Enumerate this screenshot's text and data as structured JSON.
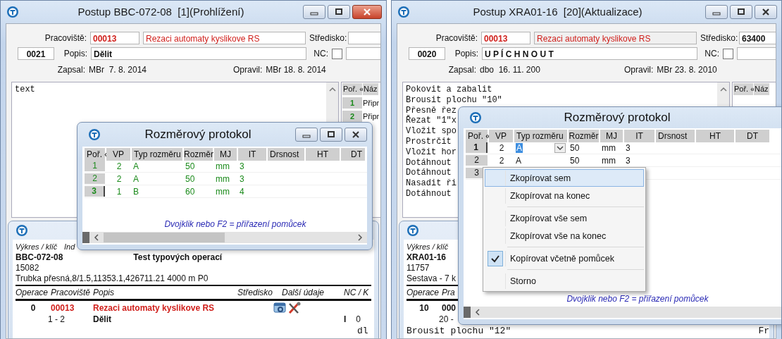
{
  "windows": [
    {
      "title": "Postup BBC-072-08  [1](Prohlížení)",
      "active": true,
      "form": {
        "workplace_label": "Pracoviště:",
        "workplace_code": "00013",
        "workplace_name": "Rezaci automaty kyslikove RS",
        "center_label": "Středisko:",
        "op_number": "0021",
        "desc_label": "Popis:",
        "desc": "Dělit",
        "nc_label": "NC:",
        "nc_checked": false,
        "created_label": "Zapsal:",
        "created": "MBr  7. 8. 2014",
        "modified_label": "Opravil:",
        "modified": "MBr 18. 8. 2014"
      },
      "notes": [
        "text"
      ],
      "side_table": {
        "columns": [
          "Poř. «",
          "Náz"
        ],
        "rows": [
          {
            "order": "1",
            "name": "Připr"
          },
          {
            "order": "2",
            "name": "Připr"
          }
        ]
      },
      "report": {
        "labels": [
          "Výkres / klíč",
          "Ind"
        ],
        "drawing": "BBC-072-08",
        "name": "Test typových operací",
        "number": "15082",
        "material": "Trubka přesná,8/1.5,11353.1,426711.21 4000 m P0",
        "columns": [
          "Operace",
          "Pracoviště",
          "Popis",
          "Středisko",
          "Další údaje",
          "NC / K"
        ],
        "rows": [
          {
            "kind": "operation",
            "number": "0",
            "workplace": "00013",
            "desc": "Rezaci automaty kyslikove RS",
            "emphasized": true,
            "tools": true
          },
          {
            "kind": "step",
            "range": "1 - 2",
            "desc": "Dělit",
            "nc": "I",
            "k": "0"
          },
          {
            "kind": "nc_note",
            "text": "dl"
          }
        ]
      },
      "dialog": {
        "title": "Rozměrový protokol",
        "controls": true,
        "readonly": true,
        "columns": [
          "Poř. «",
          "VP",
          "Typ rozměru",
          "Rozměr",
          "MJ",
          "IT",
          "Drsnost",
          "HT",
          "DT"
        ],
        "rows": [
          {
            "selected": false,
            "editing": false,
            "cells": [
              "1",
              "2",
              "A",
              "50",
              "mm",
              "3"
            ]
          },
          {
            "selected": false,
            "editing": false,
            "cells": [
              "2",
              "2",
              "A",
              "50",
              "mm",
              "3"
            ]
          },
          {
            "selected": true,
            "editing": false,
            "cells": [
              "3",
              "1",
              "B",
              "60",
              "mm",
              "4"
            ]
          }
        ],
        "hint": "Dvojklik nebo F2 = přiřazení pomůcek"
      }
    },
    {
      "title": "Postup XRA01-16  [20](Aktualizace)",
      "active": false,
      "form": {
        "workplace_label": "Pracoviště:",
        "workplace_code": "00013",
        "workplace_name": "Rezaci automaty kyslikove RS",
        "center_label": "Středisko:",
        "center_value": "63400",
        "op_number": "0020",
        "desc_label": "Popis:",
        "desc": "U P Í C H N O U T",
        "nc_label": "NC:",
        "nc_checked": false,
        "created_label": "Zapsal:",
        "created": "dbo  16. 11. 200",
        "modified_label": "Opravil:",
        "modified": "MBr 23. 8. 2010"
      },
      "notes": [
        "Pokovit a zabalit",
        "Brousit plochu \"10\"",
        "Přesně řez",
        "Řezat \"1\"x",
        "Vložit spo",
        "Prostrčit",
        "Vložit hor",
        "Dotáhnout",
        "Dotáhnout",
        "Nasadit ři",
        "Dotáhnout"
      ],
      "side_table": {
        "columns": [
          "Poř. «",
          "Náz"
        ]
      },
      "report": {
        "labels": [
          "Výkres / klíč"
        ],
        "drawing": "XRA01-16",
        "number": "11757",
        "material": "Sestava - 7 k",
        "columns": [
          "Operace",
          "Pra"
        ],
        "rows": [
          {
            "kind": "operation",
            "number": "10",
            "workplace": "000",
            "emphasized": false
          },
          {
            "kind": "step",
            "range": "20 -"
          },
          {
            "kind": "note",
            "text": "Brousit plochu \"12\"",
            "extra": "Fr"
          }
        ]
      },
      "dialog": {
        "title": "Rozměrový protokol",
        "controls": false,
        "readonly": false,
        "columns": [
          "Poř. «",
          "VP",
          "Typ rozměru",
          "Rozměr",
          "MJ",
          "IT",
          "Drsnost",
          "HT",
          "DT"
        ],
        "rows": [
          {
            "selected": true,
            "editing": true,
            "cells": [
              "1",
              "2",
              "A",
              "50",
              "mm",
              "3"
            ]
          },
          {
            "selected": false,
            "editing": false,
            "cells": [
              "2",
              "2",
              "A",
              "50",
              "mm",
              "3"
            ]
          },
          {
            "selected": false,
            "cells": [
              "3"
            ]
          }
        ],
        "hint": "Dvojklik nebo F2 = přiřazení pomůcek",
        "menu": {
          "items": [
            {
              "kind": "item",
              "label": "Zkopírovat sem",
              "highlighted": true,
              "checked": false
            },
            {
              "kind": "item",
              "label": "Zkopírovat na konec",
              "highlighted": false,
              "checked": false
            },
            {
              "kind": "separator"
            },
            {
              "kind": "item",
              "label": "Zkopírovat vše sem",
              "highlighted": false,
              "checked": false
            },
            {
              "kind": "item",
              "label": "Zkopírovat vše na konec",
              "highlighted": false,
              "checked": false
            },
            {
              "kind": "separator"
            },
            {
              "kind": "item",
              "label": "Kopírovat včetně pomůcek",
              "highlighted": false,
              "checked": true
            },
            {
              "kind": "separator"
            },
            {
              "kind": "item",
              "label": "Storno",
              "highlighted": false,
              "checked": false
            }
          ]
        }
      }
    }
  ]
}
